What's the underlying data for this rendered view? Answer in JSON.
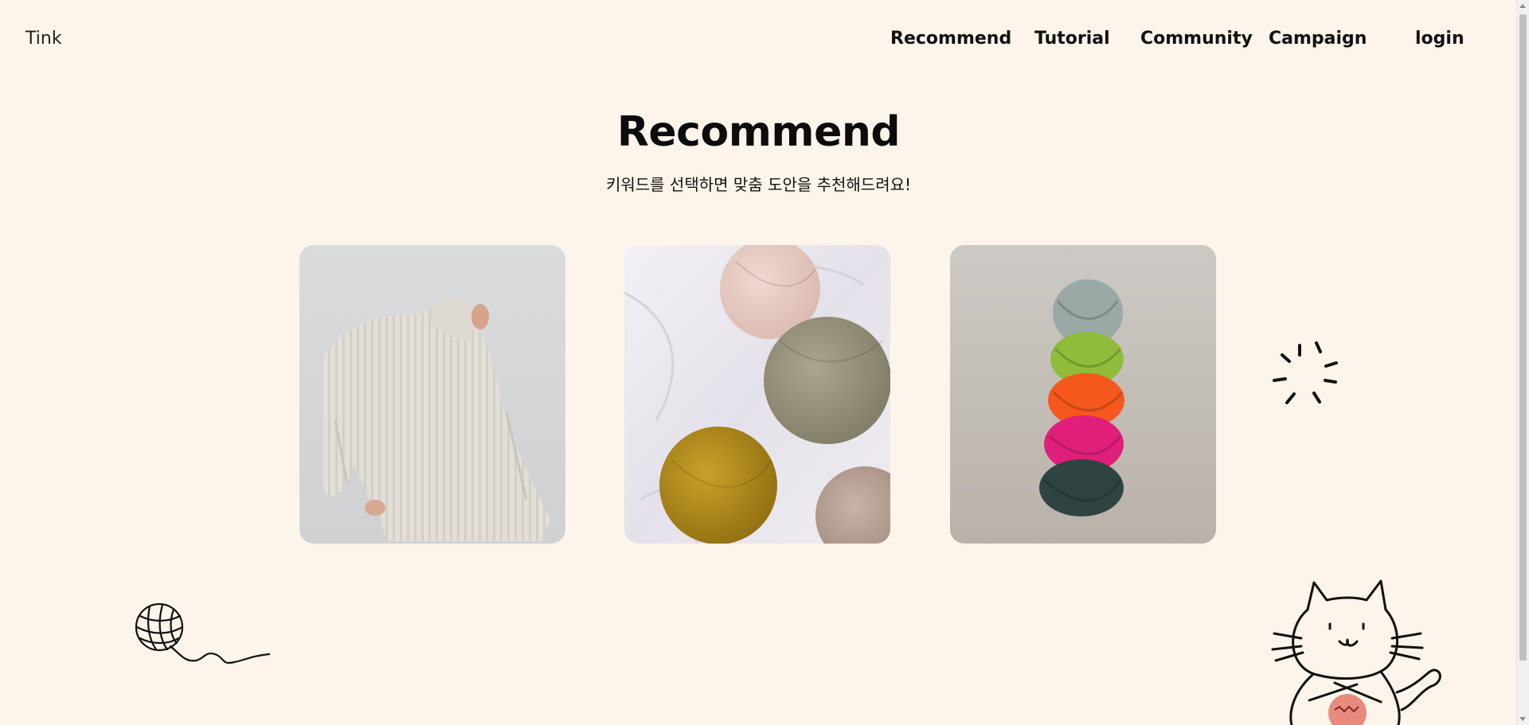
{
  "header": {
    "brand": "Tink",
    "nav": [
      {
        "label": "Recommend"
      },
      {
        "label": "Tutorial"
      },
      {
        "label": "Community"
      },
      {
        "label": "Campaign"
      },
      {
        "label": "login"
      }
    ]
  },
  "hero": {
    "title": "Recommend",
    "subtitle": "키워드를 선택하면 맞춤 도안을 추천해드려요!"
  },
  "cards": [
    {
      "icon": "knit-sweater-photo"
    },
    {
      "icon": "yarn-balls-photo"
    },
    {
      "icon": "braided-yarn-skein-photo"
    }
  ],
  "decorations": {
    "sparkle": "sparkle-icon",
    "yarn_ball": "yarn-ball-icon",
    "cat": "knitting-cat-icon"
  },
  "colors": {
    "background": "#fdf5eb",
    "text": "#111111"
  }
}
